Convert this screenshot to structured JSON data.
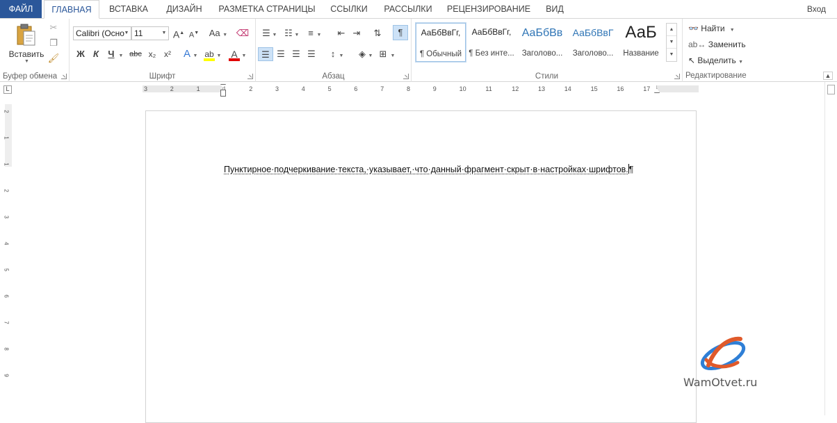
{
  "tabs": {
    "file": "ФАЙЛ",
    "home": "ГЛАВНАЯ",
    "insert": "ВСТАВКА",
    "design": "ДИЗАЙН",
    "layout": "РАЗМЕТКА СТРАНИЦЫ",
    "references": "ССЫЛКИ",
    "mailings": "РАССЫЛКИ",
    "review": "РЕЦЕНЗИРОВАНИЕ",
    "view": "ВИД"
  },
  "signin": "Вход",
  "clipboard": {
    "paste_label": "Вставить",
    "group_label": "Буфер обмена"
  },
  "font": {
    "name": "Calibri (Осно",
    "size": "11",
    "group_label": "Шрифт",
    "bold": "Ж",
    "italic": "К",
    "underline": "Ч",
    "strike": "abc",
    "subscript": "x₂",
    "superscript": "x²",
    "case": "Aa",
    "grow": "A",
    "shrink": "A"
  },
  "paragraph": {
    "group_label": "Абзац",
    "show_marks": "¶"
  },
  "styles": {
    "group_label": "Стили",
    "items": [
      {
        "sample": "АаБбВвГг,",
        "name": "¶ Обычный"
      },
      {
        "sample": "АаБбВвГг,",
        "name": "¶ Без инте..."
      },
      {
        "sample": "АаБбВв",
        "name": "Заголово..."
      },
      {
        "sample": "АаБбВвГ",
        "name": "Заголово..."
      },
      {
        "sample": "АаБ",
        "name": "Название"
      }
    ]
  },
  "editing": {
    "group_label": "Редактирование",
    "find": "Найти",
    "replace": "Заменить",
    "select": "Выделить"
  },
  "ruler": {
    "h_ticks": [
      "3",
      "2",
      "1",
      "1",
      "2",
      "3",
      "4",
      "5",
      "6",
      "7",
      "8",
      "9",
      "10",
      "11",
      "12",
      "13",
      "14",
      "15",
      "16",
      "17"
    ],
    "v_ticks": [
      "2",
      "1",
      "1",
      "2",
      "3",
      "4",
      "5",
      "6",
      "7",
      "8",
      "9"
    ]
  },
  "document": {
    "text": "Пунктирное·подчеркивание·текста,·указывает,·что·данный·фрагмент·скрыт·в·настройках·шрифтов.",
    "pilcrow": "¶"
  },
  "watermark": {
    "text": "WamOtvet.ru"
  },
  "colors": {
    "accent": "#2b579a",
    "highlight": "#ffff00",
    "font_color": "#e00000",
    "style_heading": "#2e74b5"
  }
}
